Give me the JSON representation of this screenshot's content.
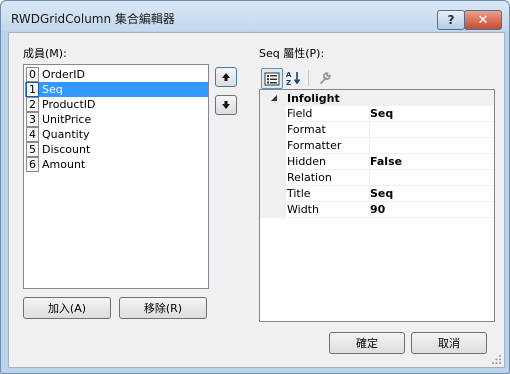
{
  "window": {
    "title": "RWDGridColumn 集合編輯器",
    "help_label": "?",
    "close_label": "✕"
  },
  "members": {
    "label": "成員(M):",
    "items": [
      {
        "index": "0",
        "name": "OrderID",
        "selected": false
      },
      {
        "index": "1",
        "name": "Seq",
        "selected": true
      },
      {
        "index": "2",
        "name": "ProductID",
        "selected": false
      },
      {
        "index": "3",
        "name": "UnitPrice",
        "selected": false
      },
      {
        "index": "4",
        "name": "Quantity",
        "selected": false
      },
      {
        "index": "5",
        "name": "Discount",
        "selected": false
      },
      {
        "index": "6",
        "name": "Amount",
        "selected": false
      }
    ],
    "add_label": "加入(A)",
    "remove_label": "移除(R)"
  },
  "properties": {
    "label": "Seq 屬性(P):",
    "toolbar": {
      "categorized_icon": "categorized-view-icon",
      "alphabetical_icon": "alphabetical-sort-icon",
      "property_pages_icon": "wrench-icon"
    },
    "category": "Infolight",
    "rows": [
      {
        "name": "Field",
        "value": "Seq"
      },
      {
        "name": "Format",
        "value": ""
      },
      {
        "name": "Formatter",
        "value": ""
      },
      {
        "name": "Hidden",
        "value": "False"
      },
      {
        "name": "Relation",
        "value": ""
      },
      {
        "name": "Title",
        "value": "Seq"
      },
      {
        "name": "Width",
        "value": "90"
      }
    ]
  },
  "footer": {
    "ok_label": "確定",
    "cancel_label": "取消"
  }
}
